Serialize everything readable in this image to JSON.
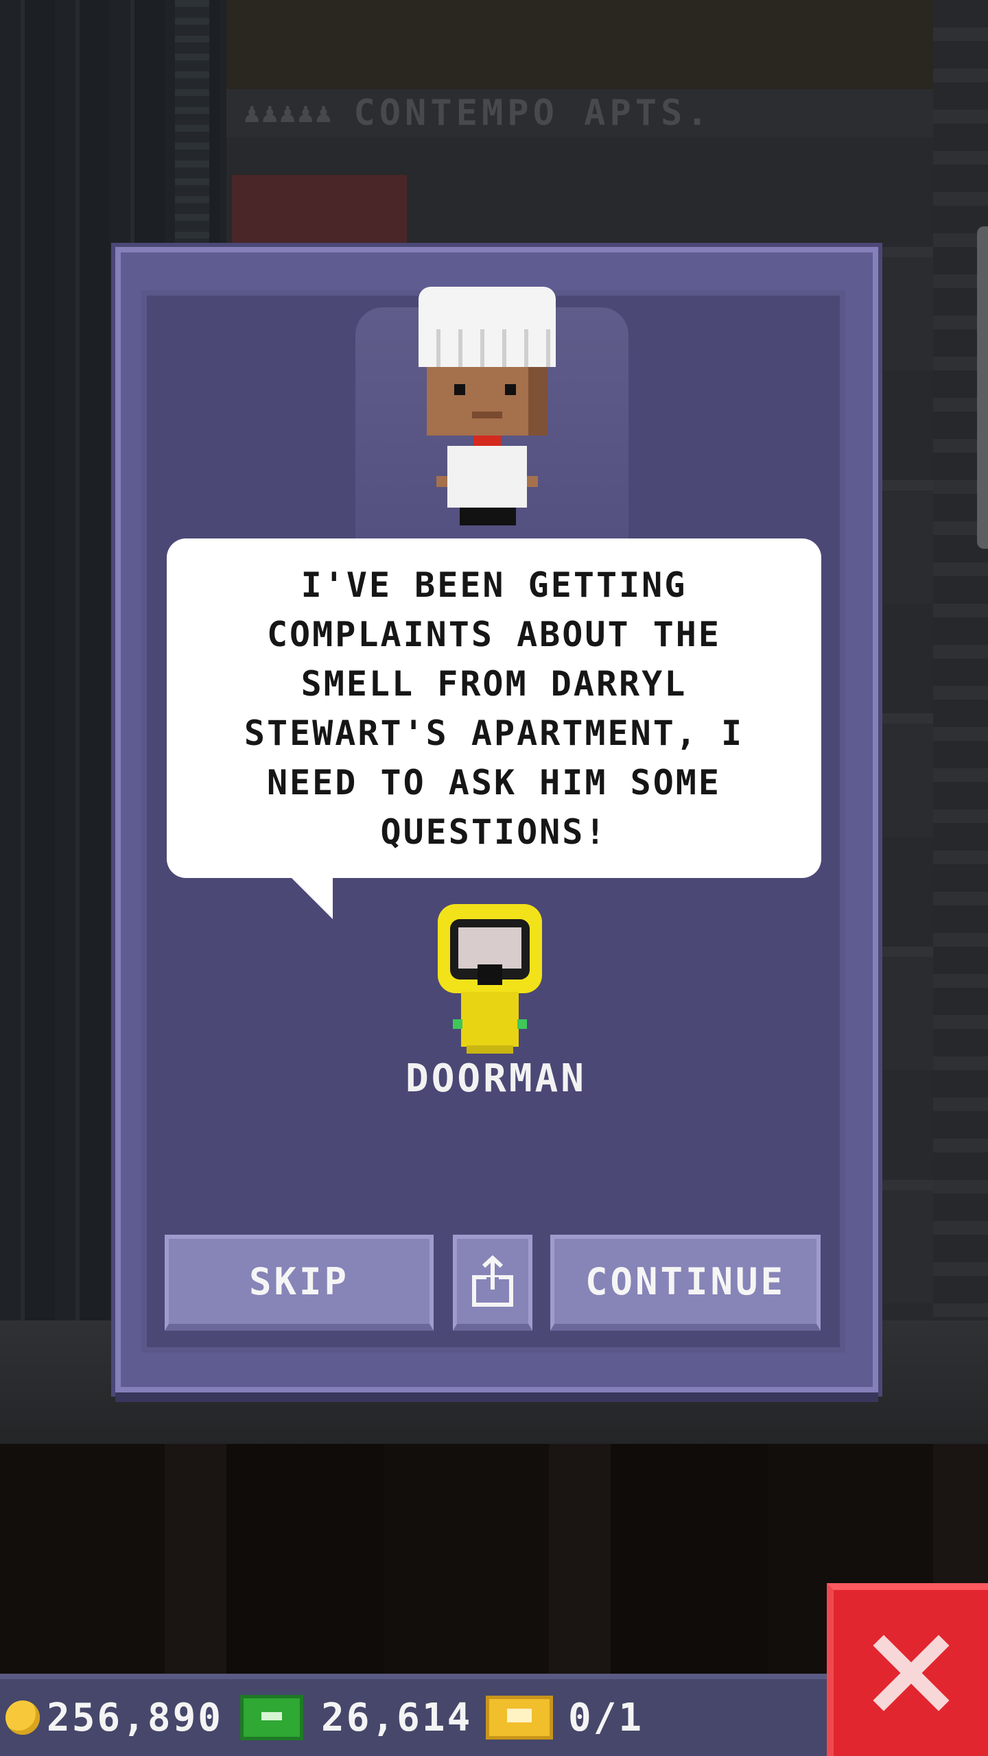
{
  "building": {
    "floor_name": "CONTEMPO APTS."
  },
  "dialog": {
    "message": "I'VE BEEN GETTING\nCOMPLAINTS ABOUT THE\nSMELL FROM DARRYL\nSTEWART'S APARTMENT, I\nNEED TO ASK HIM SOME\nQUESTIONS!",
    "speaker_name": "DOORMAN",
    "buttons": {
      "skip": "SKIP",
      "continue": "CONTINUE",
      "share_icon": "share-icon"
    }
  },
  "hud": {
    "coins": "256,890",
    "bux": "26,614",
    "tickets": "0/1",
    "icons": [
      "coin-icon",
      "bux-icon",
      "golden-ticket-icon"
    ]
  },
  "close_icon": "close-icon",
  "colors": {
    "dialog": "#5f5c92",
    "dialog_inner": "#4b4876",
    "button": "#8784b8",
    "close": "#e2262f",
    "hazmat": "#f2e21a"
  }
}
